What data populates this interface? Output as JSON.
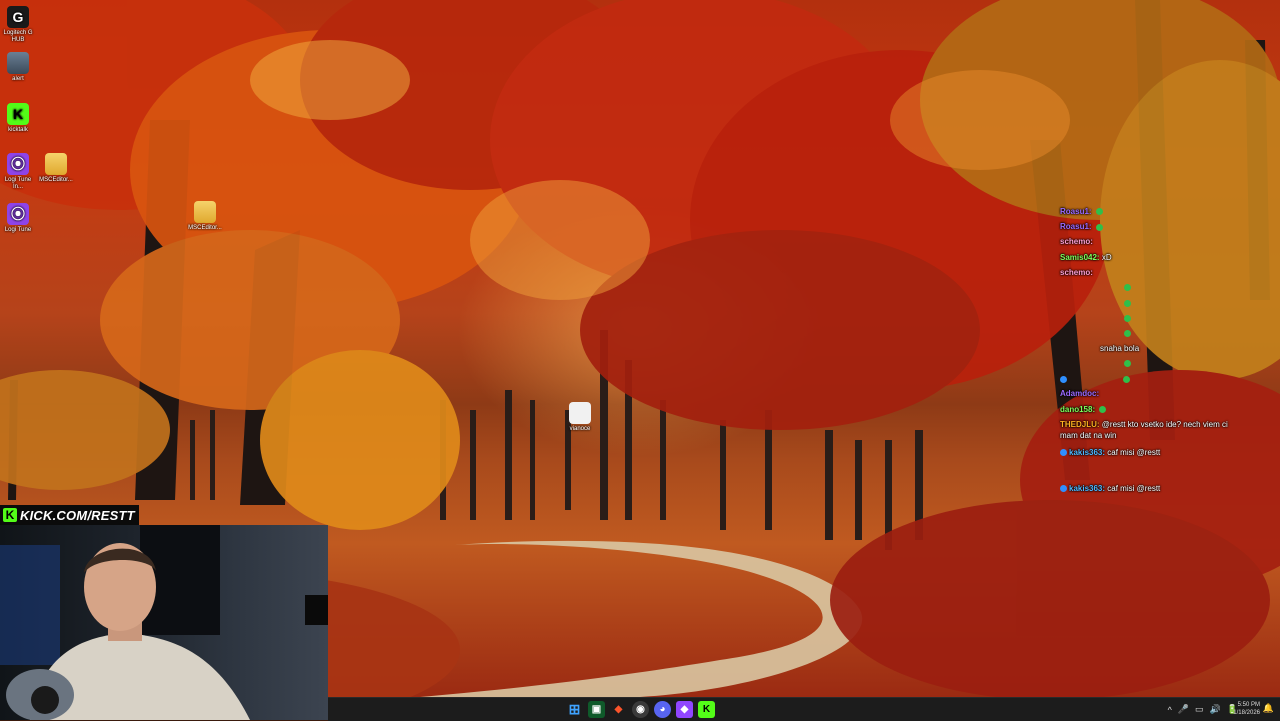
{
  "desktop": {
    "icons": [
      {
        "label": "Logitech G HUB",
        "glyph": "G"
      },
      {
        "label": "alert",
        "glyph": "▮"
      },
      {
        "label": "kicktalk",
        "glyph": "K"
      },
      {
        "label": "Logi Tune In...",
        "glyph": "⦿"
      },
      {
        "label": "MSCEditor...",
        "glyph": ""
      },
      {
        "label": "Logi Tune",
        "glyph": "⦿"
      },
      {
        "label": "MSCEditor...",
        "glyph": ""
      },
      {
        "label": "vianoce",
        "glyph": ""
      }
    ]
  },
  "chat": {
    "messages": [
      {
        "user": "Roasu1:",
        "text": "",
        "color": "#9b6bff",
        "badge": true
      },
      {
        "user": "Roasu1:",
        "text": "",
        "color": "#9b6bff",
        "badge": true
      },
      {
        "user": "schemo:",
        "text": "",
        "color": "#ff9ed2",
        "badge": false
      },
      {
        "user": "Samis042:",
        "text": "xD",
        "color": "#7dff5a",
        "badge": false
      },
      {
        "user": "schemo:",
        "text": "",
        "color": "#ff9ed2",
        "badge": false
      },
      {
        "user": "",
        "text": "",
        "color": "#ff3b3b",
        "badge": true
      },
      {
        "user": "",
        "text": "",
        "color": "#ff3b3b",
        "badge": true
      },
      {
        "user": "",
        "text": "",
        "color": "#ff3b3b",
        "badge": true
      },
      {
        "user": "",
        "text": "",
        "color": "#ff3b3b",
        "badge": true
      },
      {
        "user": "",
        "text": "snaha bola",
        "color": "#ff3b3b",
        "badge": false
      },
      {
        "user": "",
        "text": "",
        "color": "#ff3b3b",
        "badge": true
      },
      {
        "user": "",
        "text": "",
        "color": "#ff3b3b",
        "badge": true
      },
      {
        "user": "Adamdoc:",
        "text": "",
        "color": "#9b6bff",
        "badge": false
      },
      {
        "user": "dano158:",
        "text": "",
        "color": "#7dff5a",
        "badge": true
      }
    ],
    "long_messages": [
      {
        "user": "THEDJLU:",
        "text": "@restt kto vsetko ide? nech viem ci mam dat na win",
        "color": "#ffb020"
      },
      {
        "user": "kakis363:",
        "text": "caf misi @restt",
        "color": "#4db8ff"
      },
      {
        "user": "kakis363:",
        "text": "caf misi @restt",
        "color": "#4db8ff"
      }
    ]
  },
  "stream": {
    "kick_url": "KICK.COM/RESTT",
    "kick_glyph": "K"
  },
  "taskbar": {
    "start_glyph": "⊞",
    "apps": [
      {
        "name": "start",
        "glyph": "⊞",
        "color": "#3fa3ff"
      },
      {
        "name": "terminal",
        "glyph": "▣",
        "color": "#0f5a2a"
      },
      {
        "name": "brave",
        "glyph": "◆",
        "color": "#fb542b"
      },
      {
        "name": "obs",
        "glyph": "◉",
        "color": "#3a3a3a"
      },
      {
        "name": "discord",
        "glyph": "◕",
        "color": "#5865f2"
      },
      {
        "name": "twitch",
        "glyph": "◆",
        "color": "#9146ff"
      },
      {
        "name": "kick",
        "glyph": "K",
        "color": "#53fc18"
      }
    ],
    "tray": [
      "^",
      "🎤",
      "▭",
      "🔊",
      "🔋"
    ],
    "time": "5:50 PM",
    "date": "1/18/2026",
    "bell": "🔔"
  }
}
